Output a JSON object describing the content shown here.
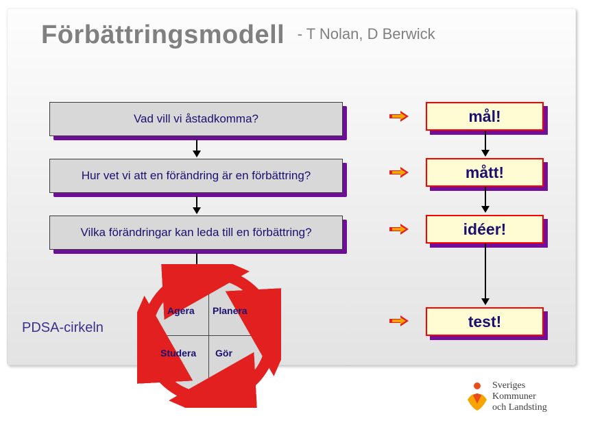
{
  "title": "Förbättringsmodell",
  "subtitle": "- T Nolan, D Berwick",
  "questions": [
    "Vad vill vi åstadkomma?",
    "Hur vet vi att en förändring är en förbättring?",
    "Vilka förändringar kan leda till en förbättring?"
  ],
  "results": [
    "mål!",
    "mått!",
    "idéer!",
    "test!"
  ],
  "pdsa": {
    "label": "PDSA-cirkeln",
    "q1": "Planera",
    "q2": "Gör",
    "q3": "Studera",
    "q4": "Agera"
  },
  "footer": {
    "line1": "Sveriges",
    "line2": "Kommuner",
    "line3": "och Landsting"
  },
  "colors": {
    "arrow_red": "#e32020",
    "arrow_yellow": "#f7a400"
  }
}
